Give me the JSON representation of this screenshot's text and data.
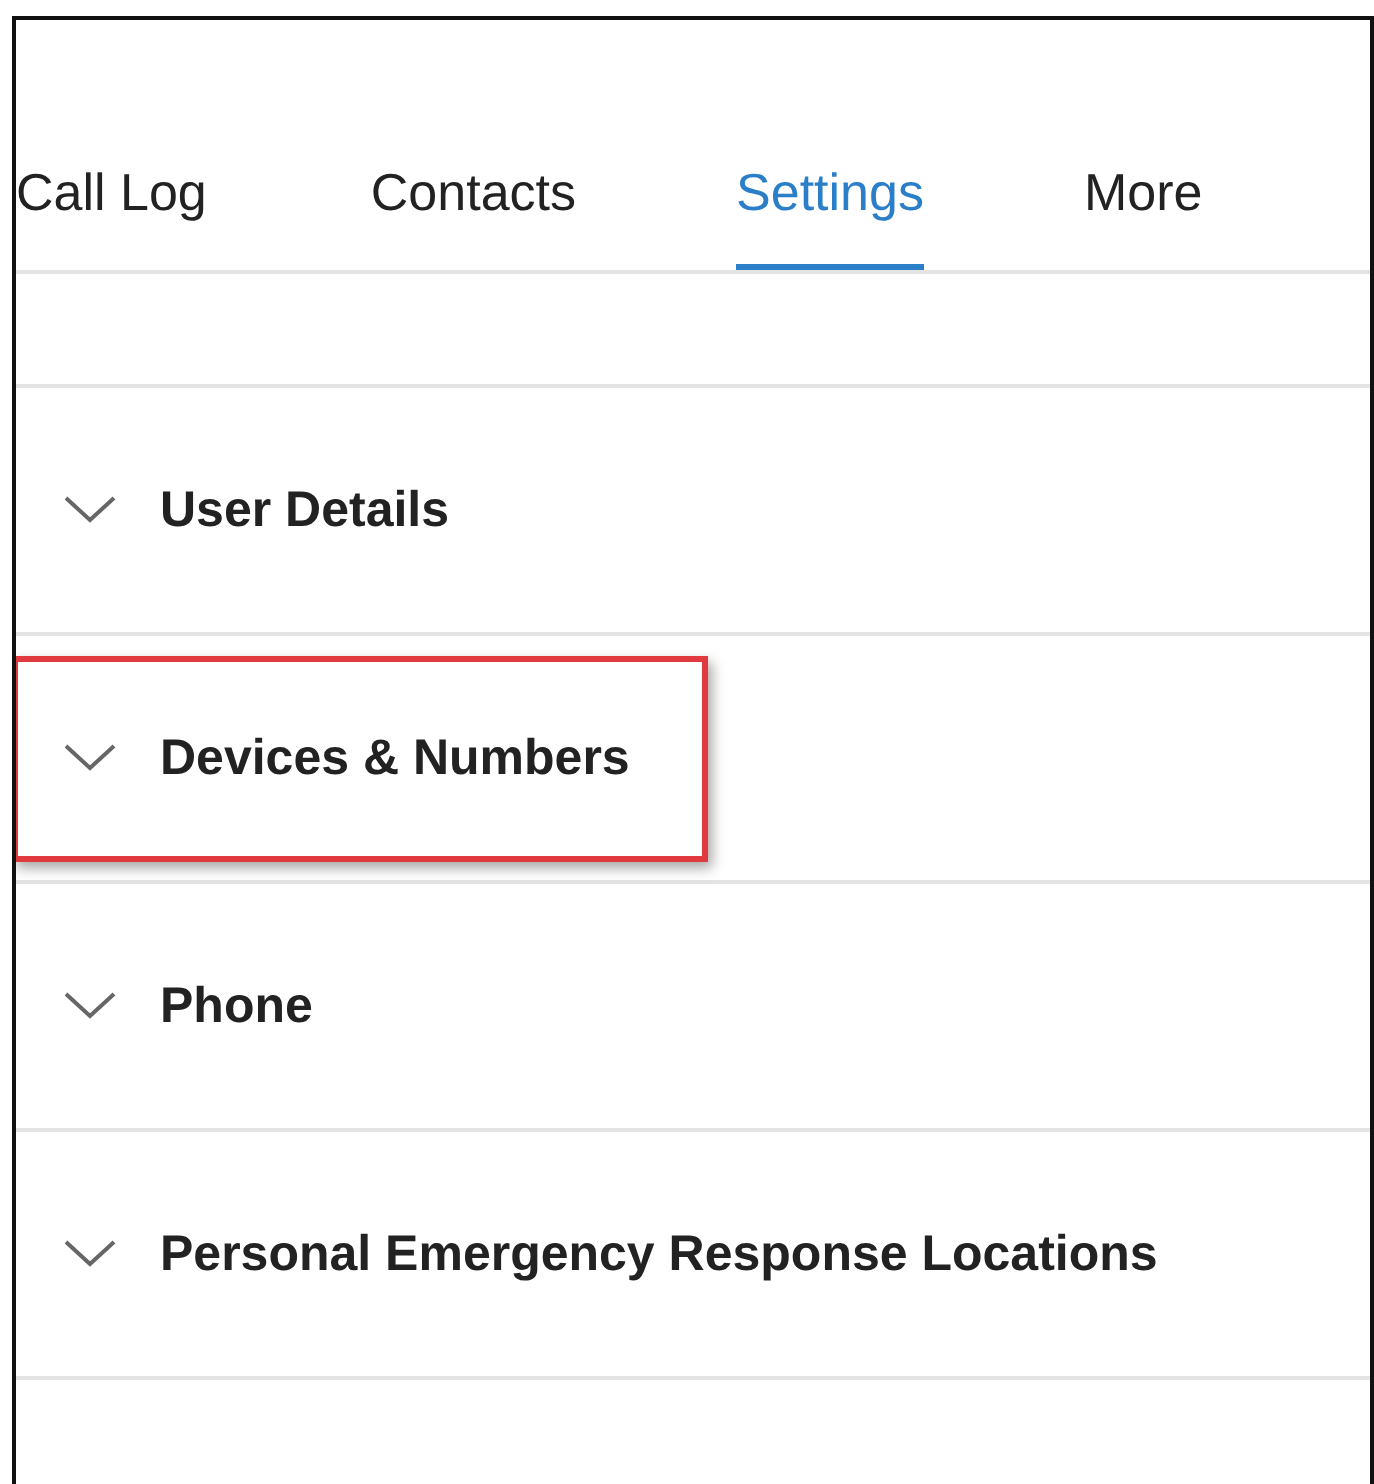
{
  "tabs": [
    {
      "label": "Call Log",
      "selected": false
    },
    {
      "label": "Contacts",
      "selected": false
    },
    {
      "label": "Settings",
      "selected": true
    },
    {
      "label": "More",
      "selected": false
    }
  ],
  "sections": [
    {
      "title": "User Details",
      "expanded": false,
      "highlighted": false
    },
    {
      "title": "Devices & Numbers",
      "expanded": false,
      "highlighted": true
    },
    {
      "title": "Phone",
      "expanded": false,
      "highlighted": false
    },
    {
      "title": "Personal Emergency Response Locations",
      "expanded": false,
      "highlighted": false
    }
  ]
}
